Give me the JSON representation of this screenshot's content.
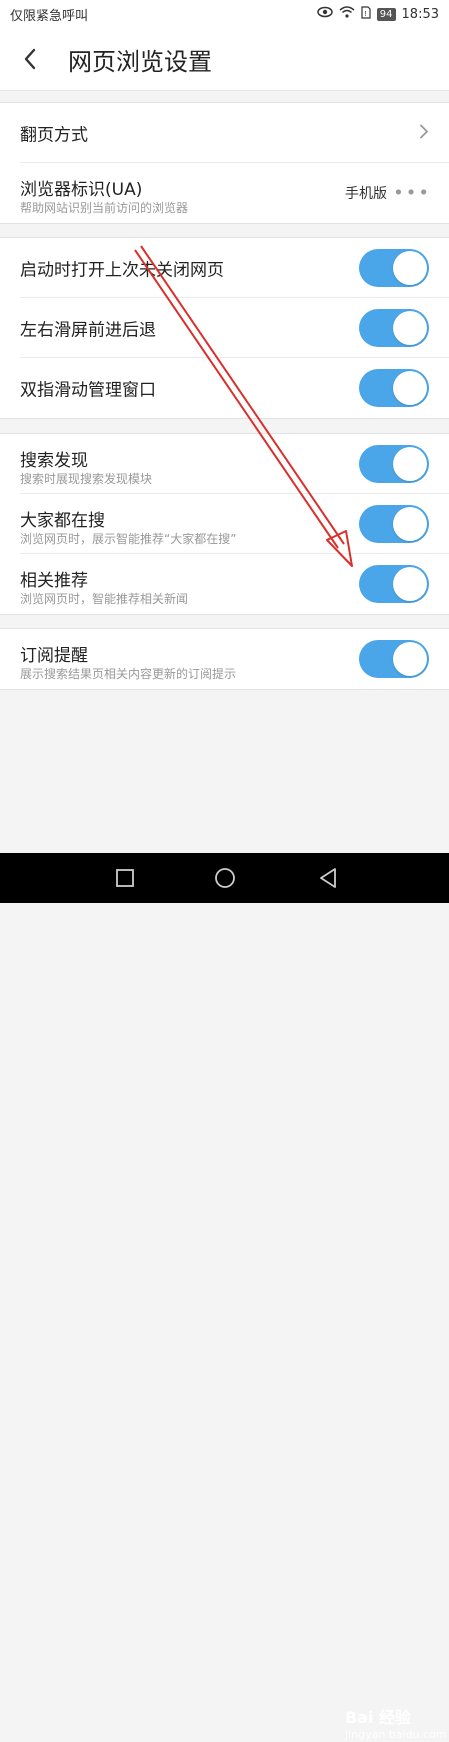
{
  "status_bar": {
    "carrier": "仅限紧急呼叫",
    "battery": "94",
    "time": "18:53",
    "icons": [
      "eye-icon",
      "wifi-icon",
      "sim-icon",
      "battery-icon"
    ]
  },
  "header": {
    "back_icon": "chevron-left-icon",
    "title": "网页浏览设置"
  },
  "group1": {
    "page_flip": {
      "label": "翻页方式",
      "icon": "chevron-right-icon"
    },
    "ua": {
      "label": "浏览器标识(UA)",
      "sub": "帮助网站识别当前访问的浏览器",
      "value": "手机版",
      "more_icon": "more-dots-icon"
    }
  },
  "group2": {
    "items": [
      {
        "label": "启动时打开上次未关闭网页",
        "on": true
      },
      {
        "label": "左右滑屏前进后退",
        "on": true
      },
      {
        "label": "双指滑动管理窗口",
        "on": true
      }
    ]
  },
  "group3": {
    "items": [
      {
        "label": "搜索发现",
        "sub": "搜索时展现搜索发现模块",
        "on": true
      },
      {
        "label": "大家都在搜",
        "sub": "浏览网页时，展示智能推荐“大家都在搜”",
        "on": true
      },
      {
        "label": "相关推荐",
        "sub": "浏览网页时，智能推荐相关新闻",
        "on": true
      }
    ]
  },
  "group4": {
    "items": [
      {
        "label": "订阅提醒",
        "sub": "展示搜索结果页相关内容更新的订阅提示",
        "on": true
      }
    ]
  },
  "navbar": {
    "icons": [
      "recent-apps-icon",
      "home-icon",
      "back-icon"
    ]
  },
  "watermark": {
    "brand": "Bai 经验",
    "url": "jingyan.baidu.com"
  },
  "colors": {
    "toggle_on": "#4aa6e8",
    "annotation_arrow": "#d9302c"
  }
}
